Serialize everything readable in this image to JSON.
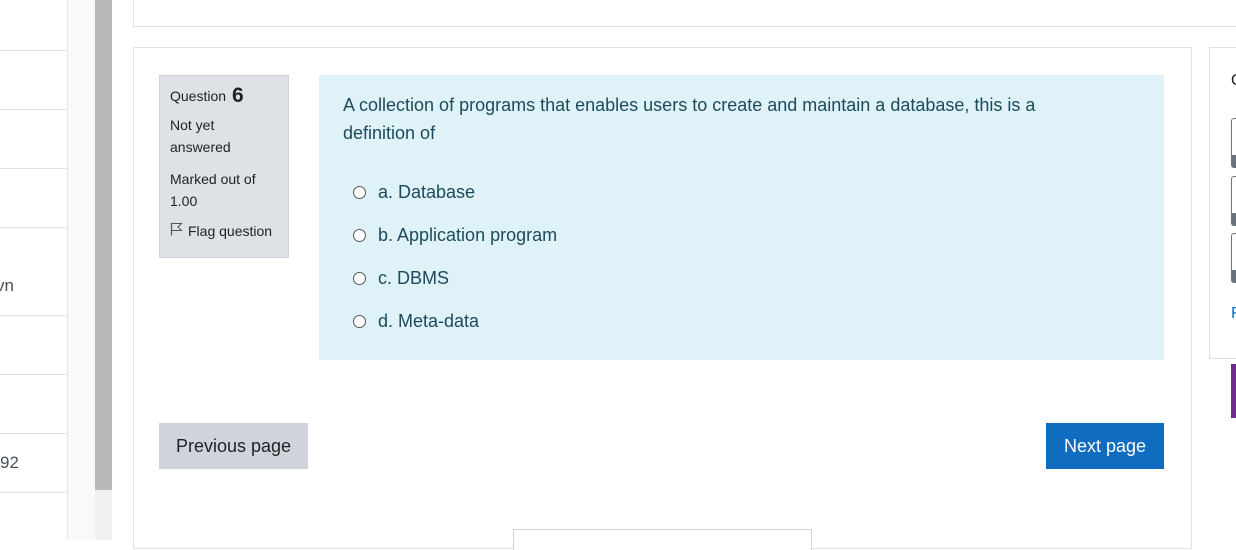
{
  "sidebar": {
    "partial_items": [
      "",
      "",
      "",
      "",
      "vn",
      "",
      "",
      "92",
      ""
    ]
  },
  "question": {
    "label": "Question",
    "number": "6",
    "state_line1": "Not yet",
    "state_line2": "answered",
    "grade_line1": "Marked out of",
    "grade_line2": "1.00",
    "flag_label": "Flag question",
    "text": "A collection of programs that enables users to create and maintain a database, this is a definition of",
    "answers": [
      {
        "label": "a. Database"
      },
      {
        "label": "b. Application program"
      },
      {
        "label": "c. DBMS"
      },
      {
        "label": "d. Meta-data"
      }
    ]
  },
  "navigation": {
    "previous_label": "Previous page",
    "next_label": "Next page"
  },
  "right_panel": {
    "heading_partial": "Q",
    "link_partial": "F"
  },
  "colors": {
    "info_bg": "#dee2e6",
    "content_bg": "#def2f8",
    "primary": "#0f6cbf",
    "secondary": "#ced4da",
    "accent_purple": "#6f2c91"
  }
}
